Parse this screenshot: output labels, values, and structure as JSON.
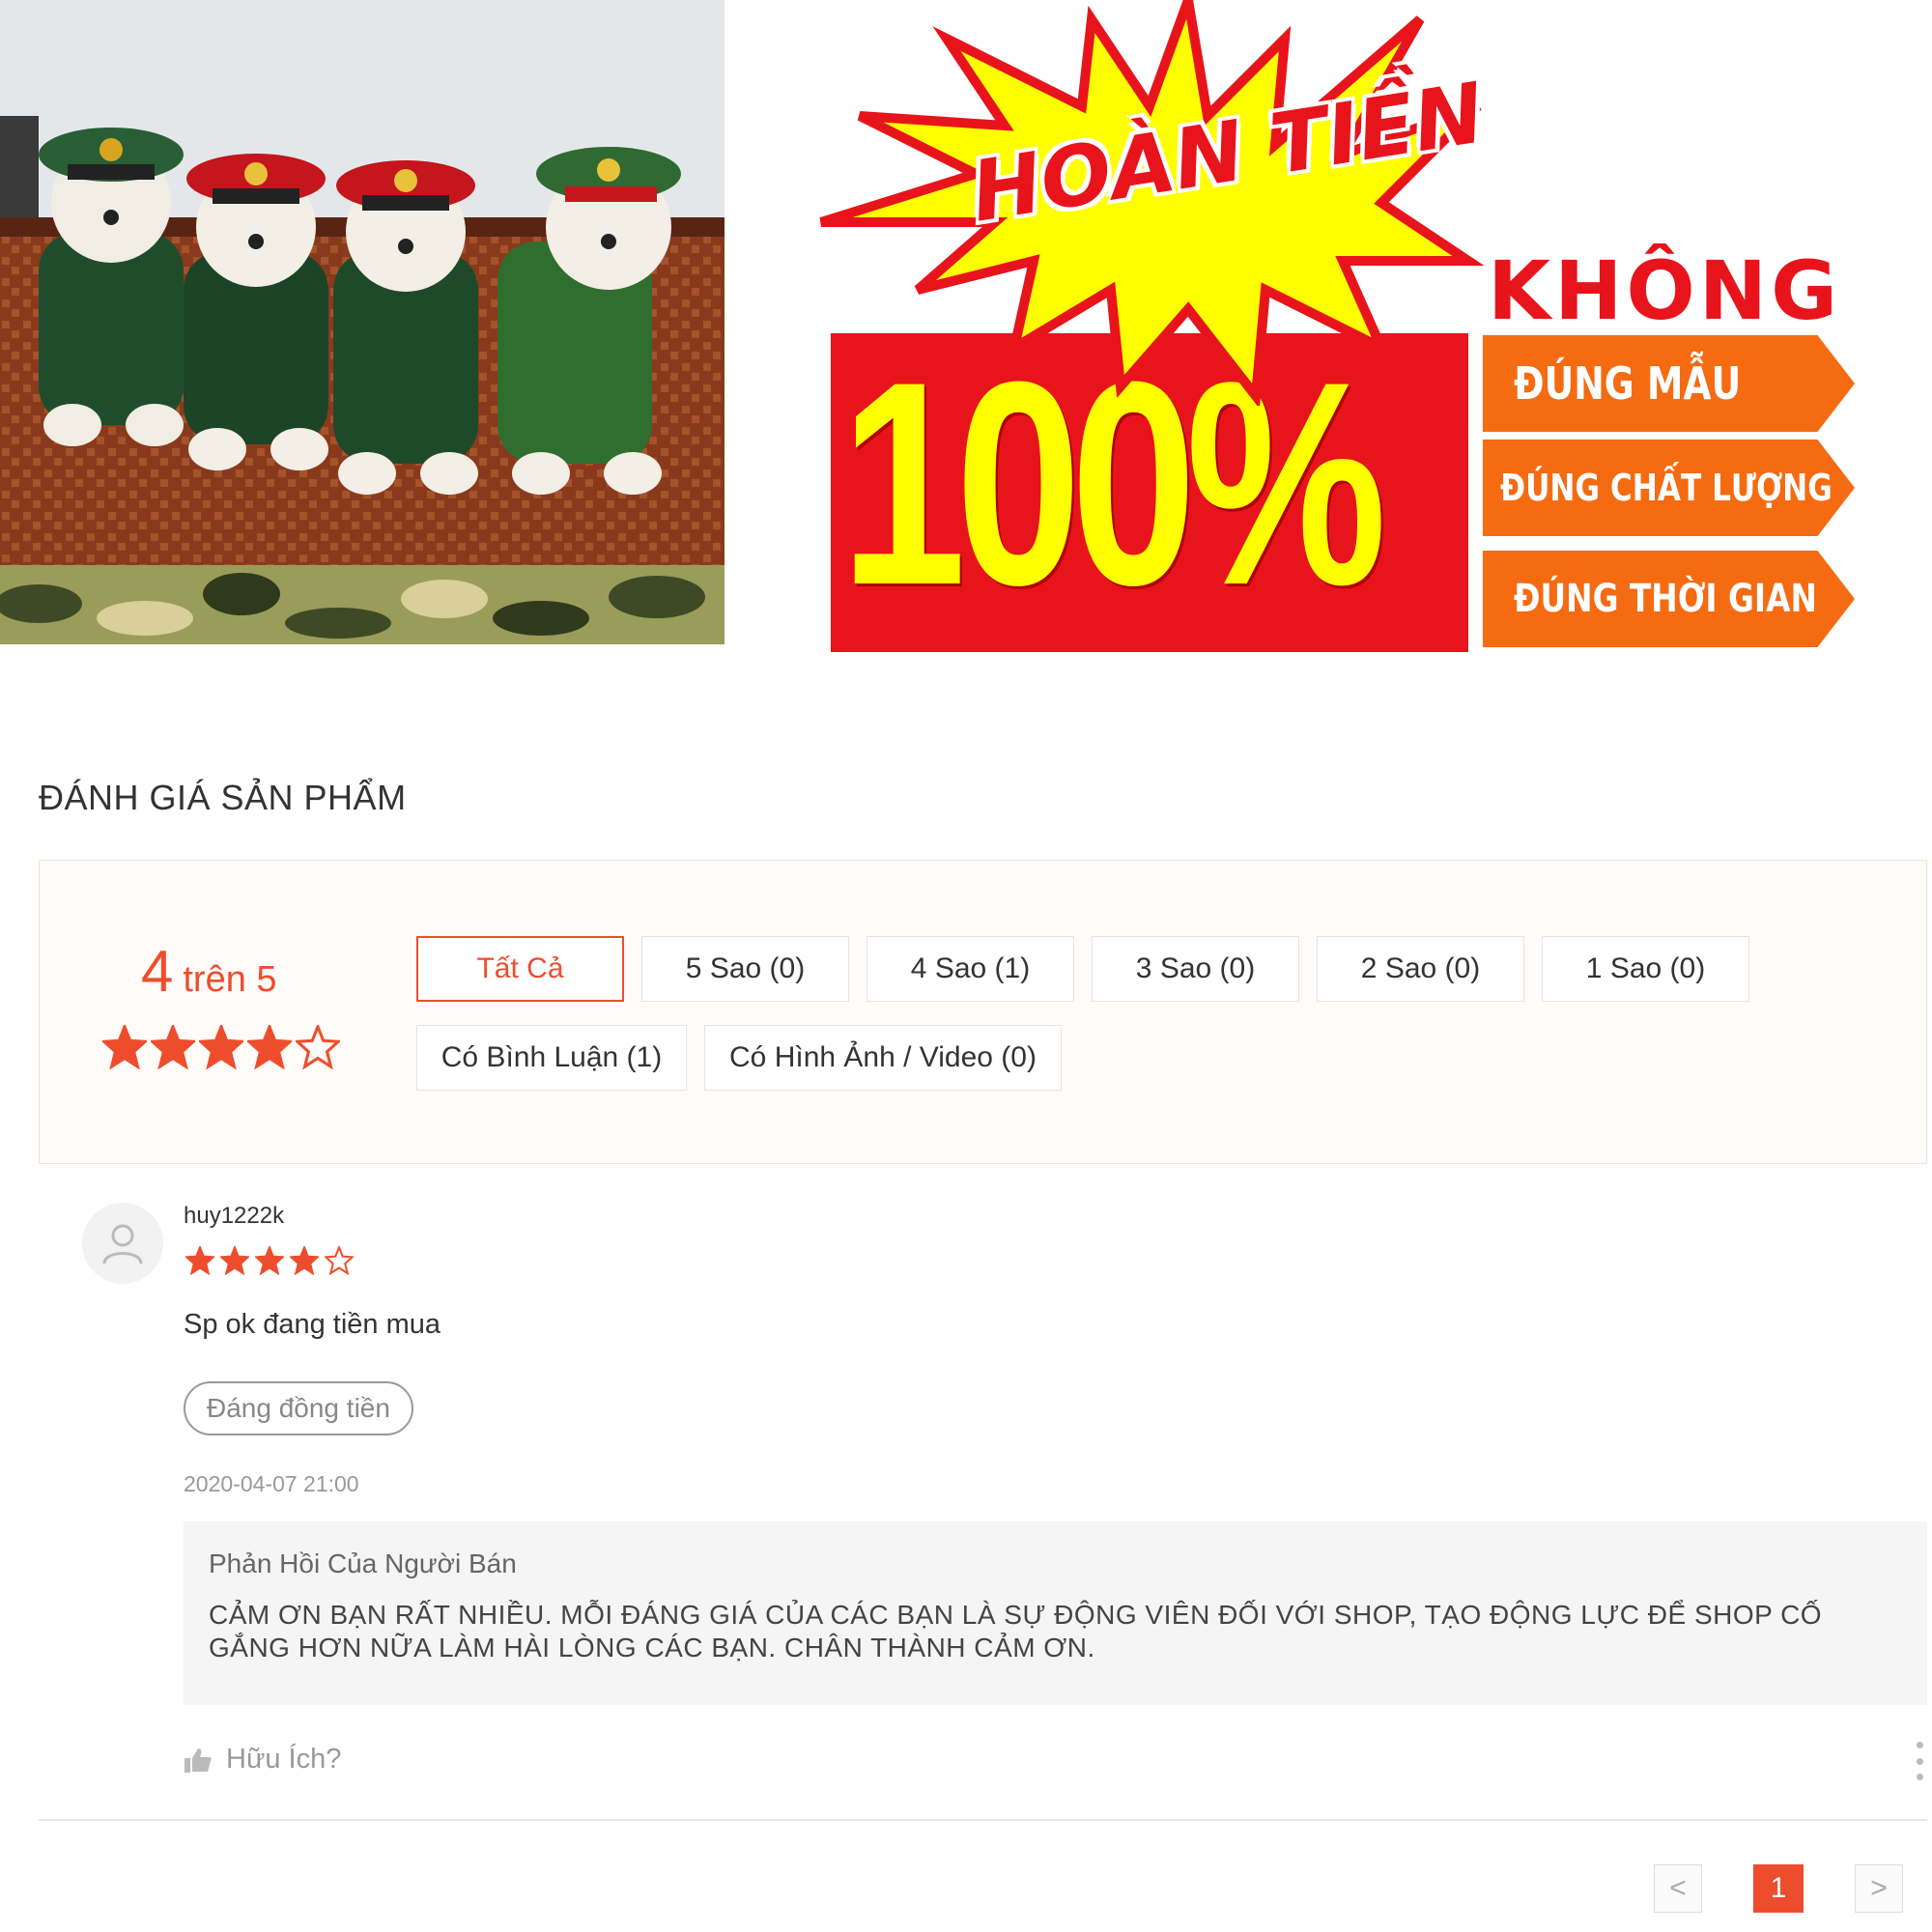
{
  "promo": {
    "hoan_tien": "HOÀN TIỀN",
    "percent": "100%",
    "khong": "KHÔNG",
    "tags": [
      "ĐÚNG MẪU",
      "ĐÚNG CHẤT LƯỢNG",
      "ĐÚNG THỜI GIAN"
    ]
  },
  "reviews_section": {
    "title": "ĐÁNH GIÁ SẢN PHẨM",
    "rating_value": "4",
    "rating_suffix": "trên 5",
    "rating_stars": 4,
    "filters": [
      {
        "label": "Tất Cả",
        "active": true
      },
      {
        "label": "5 Sao (0)",
        "active": false
      },
      {
        "label": "4 Sao (1)",
        "active": false
      },
      {
        "label": "3 Sao (0)",
        "active": false
      },
      {
        "label": "2 Sao (0)",
        "active": false
      },
      {
        "label": "1 Sao (0)",
        "active": false
      },
      {
        "label": "Có Bình Luận (1)",
        "active": false
      },
      {
        "label": "Có Hình Ảnh / Video (0)",
        "active": false
      }
    ]
  },
  "review": {
    "username": "huy1222k",
    "stars": 4,
    "comment": "Sp ok đang tiền mua",
    "tag": "Đáng đồng tiền",
    "timestamp": "2020-04-07 21:00",
    "seller_reply_title": "Phản Hồi Của Người Bán",
    "seller_reply_body": "CẢM ƠN BẠN RẤT NHIỀU. MỖI ĐÁNG GIÁ CỦA CÁC BẠN LÀ SỰ ĐỘNG VIÊN ĐỐI VỚI SHOP, TẠO ĐỘNG LỰC ĐỂ SHOP CỐ GẮNG HƠN NỮA LÀM HÀI LÒNG CÁC BẠN. CHÂN THÀNH CẢM ƠN.",
    "helpful_label": "Hữu Ích?"
  },
  "pagination": {
    "prev": "<",
    "current": "1",
    "next": ">"
  },
  "colors": {
    "accent": "#ee4d2d",
    "promo_red": "#e8141c",
    "promo_yellow": "#ffff00",
    "promo_orange": "#f56b12"
  }
}
